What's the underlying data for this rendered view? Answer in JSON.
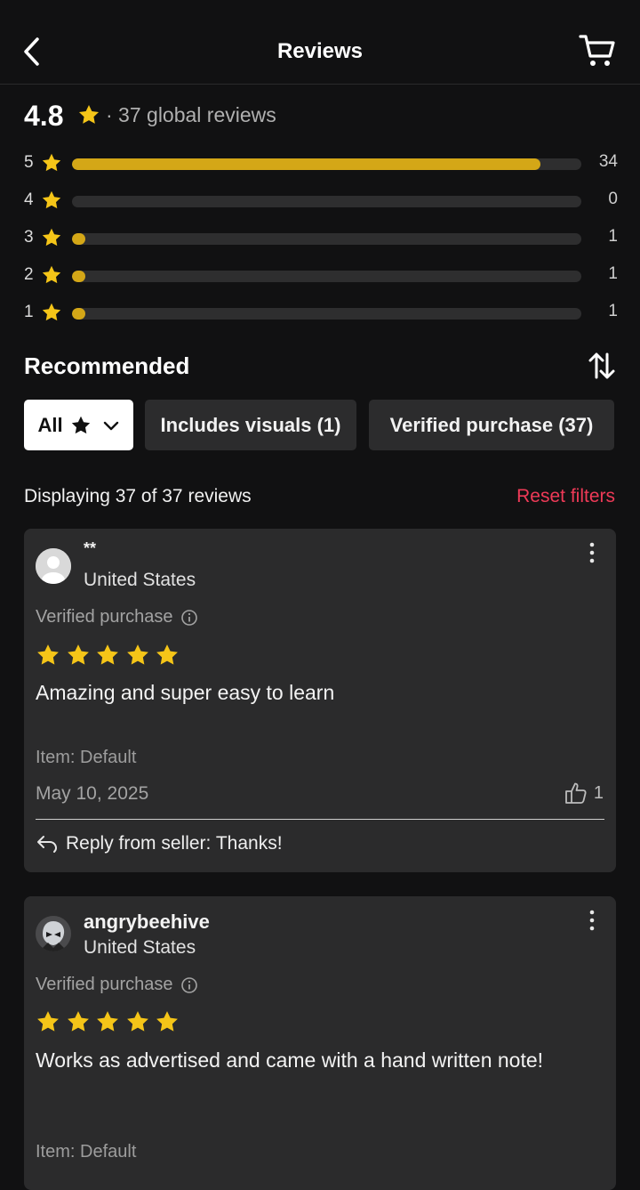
{
  "header": {
    "title": "Reviews",
    "back_icon": "chevron-left-icon",
    "cart_icon": "cart-icon"
  },
  "summary": {
    "average": "4.8",
    "count_text": "· 37 global reviews"
  },
  "distribution": [
    {
      "stars": "5",
      "count": "34",
      "fraction": 0.919
    },
    {
      "stars": "4",
      "count": "0",
      "fraction": 0
    },
    {
      "stars": "3",
      "count": "1",
      "fraction": 0.027
    },
    {
      "stars": "2",
      "count": "1",
      "fraction": 0.027
    },
    {
      "stars": "1",
      "count": "1",
      "fraction": 0.027
    }
  ],
  "section": {
    "title": "Recommended",
    "sort_icon": "sort-arrows-icon"
  },
  "filters": {
    "all_label": "All",
    "visuals_label": "Includes visuals (1)",
    "verified_label": "Verified purchase (37)"
  },
  "results": {
    "display_text": "Displaying 37 of 37 reviews",
    "reset_label": "Reset filters"
  },
  "reviews": [
    {
      "username": "*‌*",
      "location": "United States",
      "verified": "Verified purchase",
      "rating": 5,
      "text": "Amazing and super easy to learn",
      "item": "Item: Default",
      "date": "May 10, 2025",
      "likes": "1",
      "reply": "Reply from seller: Thanks!"
    },
    {
      "username": "angrybeehive",
      "location": "United States",
      "verified": "Verified purchase",
      "rating": 5,
      "text": "Works as advertised and came with a hand written note!",
      "item": "Item: Default"
    }
  ],
  "colors": {
    "background": "#111112",
    "card": "#2b2b2c",
    "star": "#f5c518",
    "bar_fill": "#d4a717",
    "accent_red": "#ee3a57"
  }
}
